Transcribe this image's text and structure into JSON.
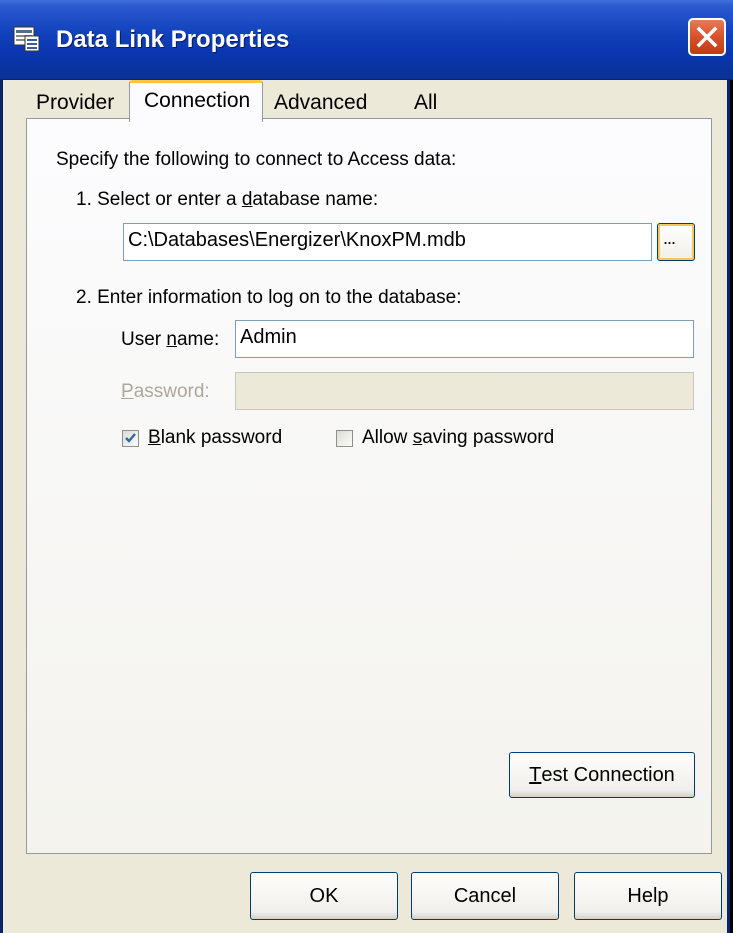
{
  "window": {
    "title": "Data Link Properties"
  },
  "tabs": [
    {
      "label": "Provider",
      "selected": false
    },
    {
      "label": "Connection",
      "selected": true
    },
    {
      "label": "Advanced",
      "selected": false
    },
    {
      "label": "All",
      "selected": false
    }
  ],
  "connection": {
    "intro": "Specify the following to connect to Access data:",
    "step1_prefix": "1. Select or enter a ",
    "step1_underlined": "d",
    "step1_suffix": "atabase name:",
    "database_path": "C:\\Databases\\Energizer\\KnoxPM.mdb",
    "browse_label": "...",
    "step2": "2. Enter information to log on to the database:",
    "username_prefix": "User ",
    "username_underlined": "n",
    "username_suffix": "ame:",
    "username_value": "Admin",
    "password_underlined": "P",
    "password_suffix": "assword:",
    "password_value": "",
    "blank_password_underlined": "B",
    "blank_password_suffix": "lank password",
    "blank_password_checked": true,
    "allow_saving_prefix": "Allow ",
    "allow_saving_underlined": "s",
    "allow_saving_suffix": "aving password",
    "allow_saving_checked": false,
    "test_underlined": "T",
    "test_suffix": "est Connection"
  },
  "footer": {
    "ok": "OK",
    "cancel": "Cancel",
    "help": "Help"
  },
  "icons": {
    "title": "data-link-icon",
    "close": "close-icon",
    "check": "checkmark-icon"
  },
  "colors": {
    "titlebar": "#0a36ad",
    "dialog_bg": "#ece9d8",
    "tab_highlight": "#ffc83c",
    "close": "#d9502a"
  }
}
